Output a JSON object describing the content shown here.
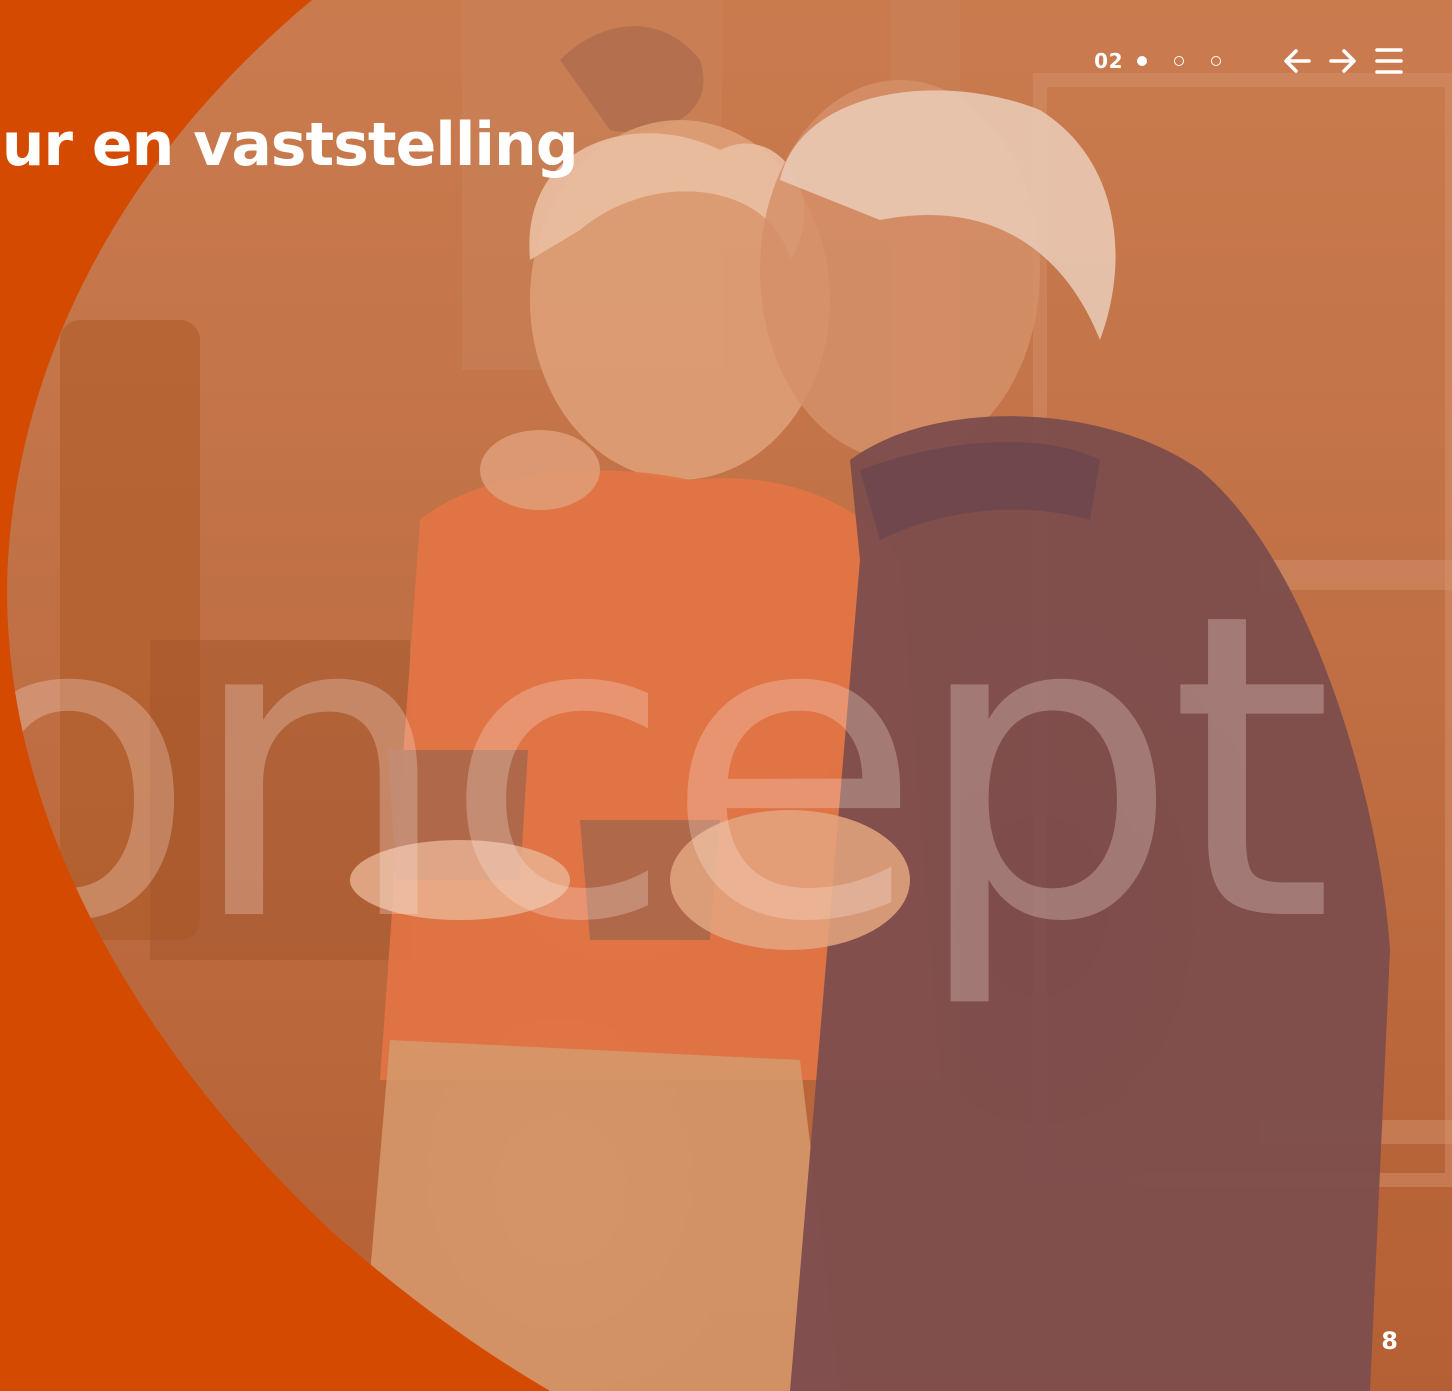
{
  "header": {
    "title": "uur en vaststelling",
    "chapter_number": "02",
    "pagination_dots": [
      {
        "state": "active"
      },
      {
        "state": "inactive"
      },
      {
        "state": "inactive"
      }
    ]
  },
  "watermark": {
    "text": "oncept"
  },
  "footer": {
    "page_number": "8"
  },
  "icons": {
    "previous": "arrow-left-icon",
    "next": "arrow-right-icon",
    "menu": "hamburger-menu-icon"
  },
  "colors": {
    "brand_orange": "#d34a00",
    "text": "#ffffff",
    "photo_tint": "#c57a52"
  }
}
